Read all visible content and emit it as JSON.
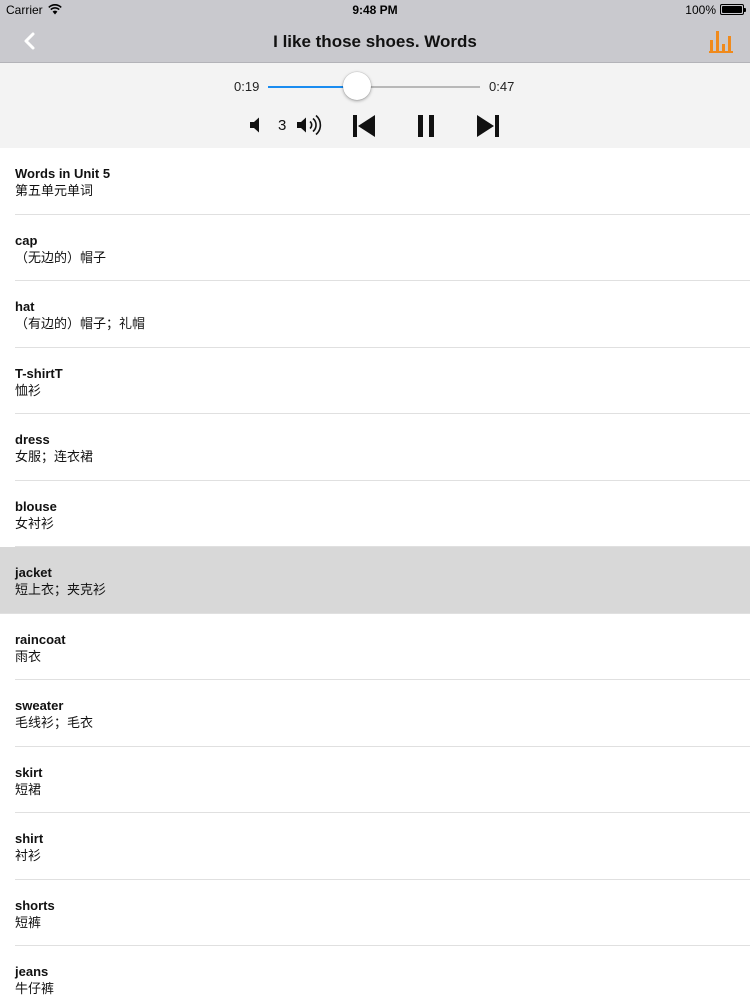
{
  "status_bar": {
    "carrier": "Carrier",
    "time": "9:48 PM",
    "battery": "100%"
  },
  "nav": {
    "title": "I like those shoes. Words",
    "back_icon": "chevron-left-icon",
    "right_icon": "bar-chart-icon",
    "accent_color": "#f08a1c"
  },
  "player": {
    "current_time": "0:19",
    "total_time": "0:47",
    "progress": 0.42,
    "volume": "3",
    "track_color": "#1a8cf0"
  },
  "words": [
    {
      "en": "Words in Unit 5",
      "zh": "第五单元单词",
      "selected": false
    },
    {
      "en": "cap",
      "zh": "（无边的）帽子",
      "selected": false
    },
    {
      "en": "hat",
      "zh": "（有边的）帽子；礼帽",
      "selected": false
    },
    {
      "en": "T-shirtT",
      "zh": "恤衫",
      "selected": false
    },
    {
      "en": "dress",
      "zh": "女服；连衣裙",
      "selected": false
    },
    {
      "en": "blouse",
      "zh": "女衬衫",
      "selected": false
    },
    {
      "en": "jacket",
      "zh": "短上衣；夹克衫",
      "selected": true
    },
    {
      "en": "raincoat",
      "zh": "雨衣",
      "selected": false
    },
    {
      "en": "sweater",
      "zh": "毛线衫；毛衣",
      "selected": false
    },
    {
      "en": "skirt",
      "zh": "短裙",
      "selected": false
    },
    {
      "en": "shirt",
      "zh": "衬衫",
      "selected": false
    },
    {
      "en": "shorts",
      "zh": "短裤",
      "selected": false
    },
    {
      "en": "jeans",
      "zh": "牛仔裤",
      "selected": false
    }
  ]
}
